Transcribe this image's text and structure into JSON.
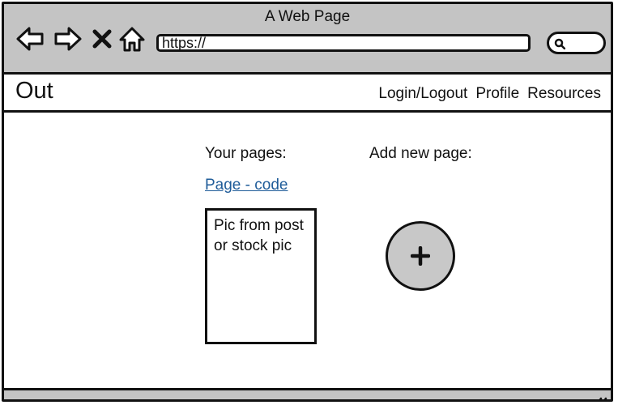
{
  "window": {
    "title": "A Web Page"
  },
  "toolbar": {
    "back_icon": "back-arrow-icon",
    "forward_icon": "forward-arrow-icon",
    "stop_icon": "close-icon",
    "home_icon": "home-icon",
    "url": "https://",
    "search_icon": "search-icon"
  },
  "site": {
    "logo": "Out",
    "nav": [
      "Login/Logout",
      "Profile",
      "Resources"
    ]
  },
  "main": {
    "your_pages_label": "Your pages:",
    "add_page_label": "Add new page:",
    "page_link": "Page - code",
    "card_text": "Pic from post or stock pic",
    "add_icon": "plus-icon"
  },
  "colors": {
    "chrome": "#c4c4c4",
    "link": "#1f5c99",
    "add_button": "#c8c8c8"
  }
}
